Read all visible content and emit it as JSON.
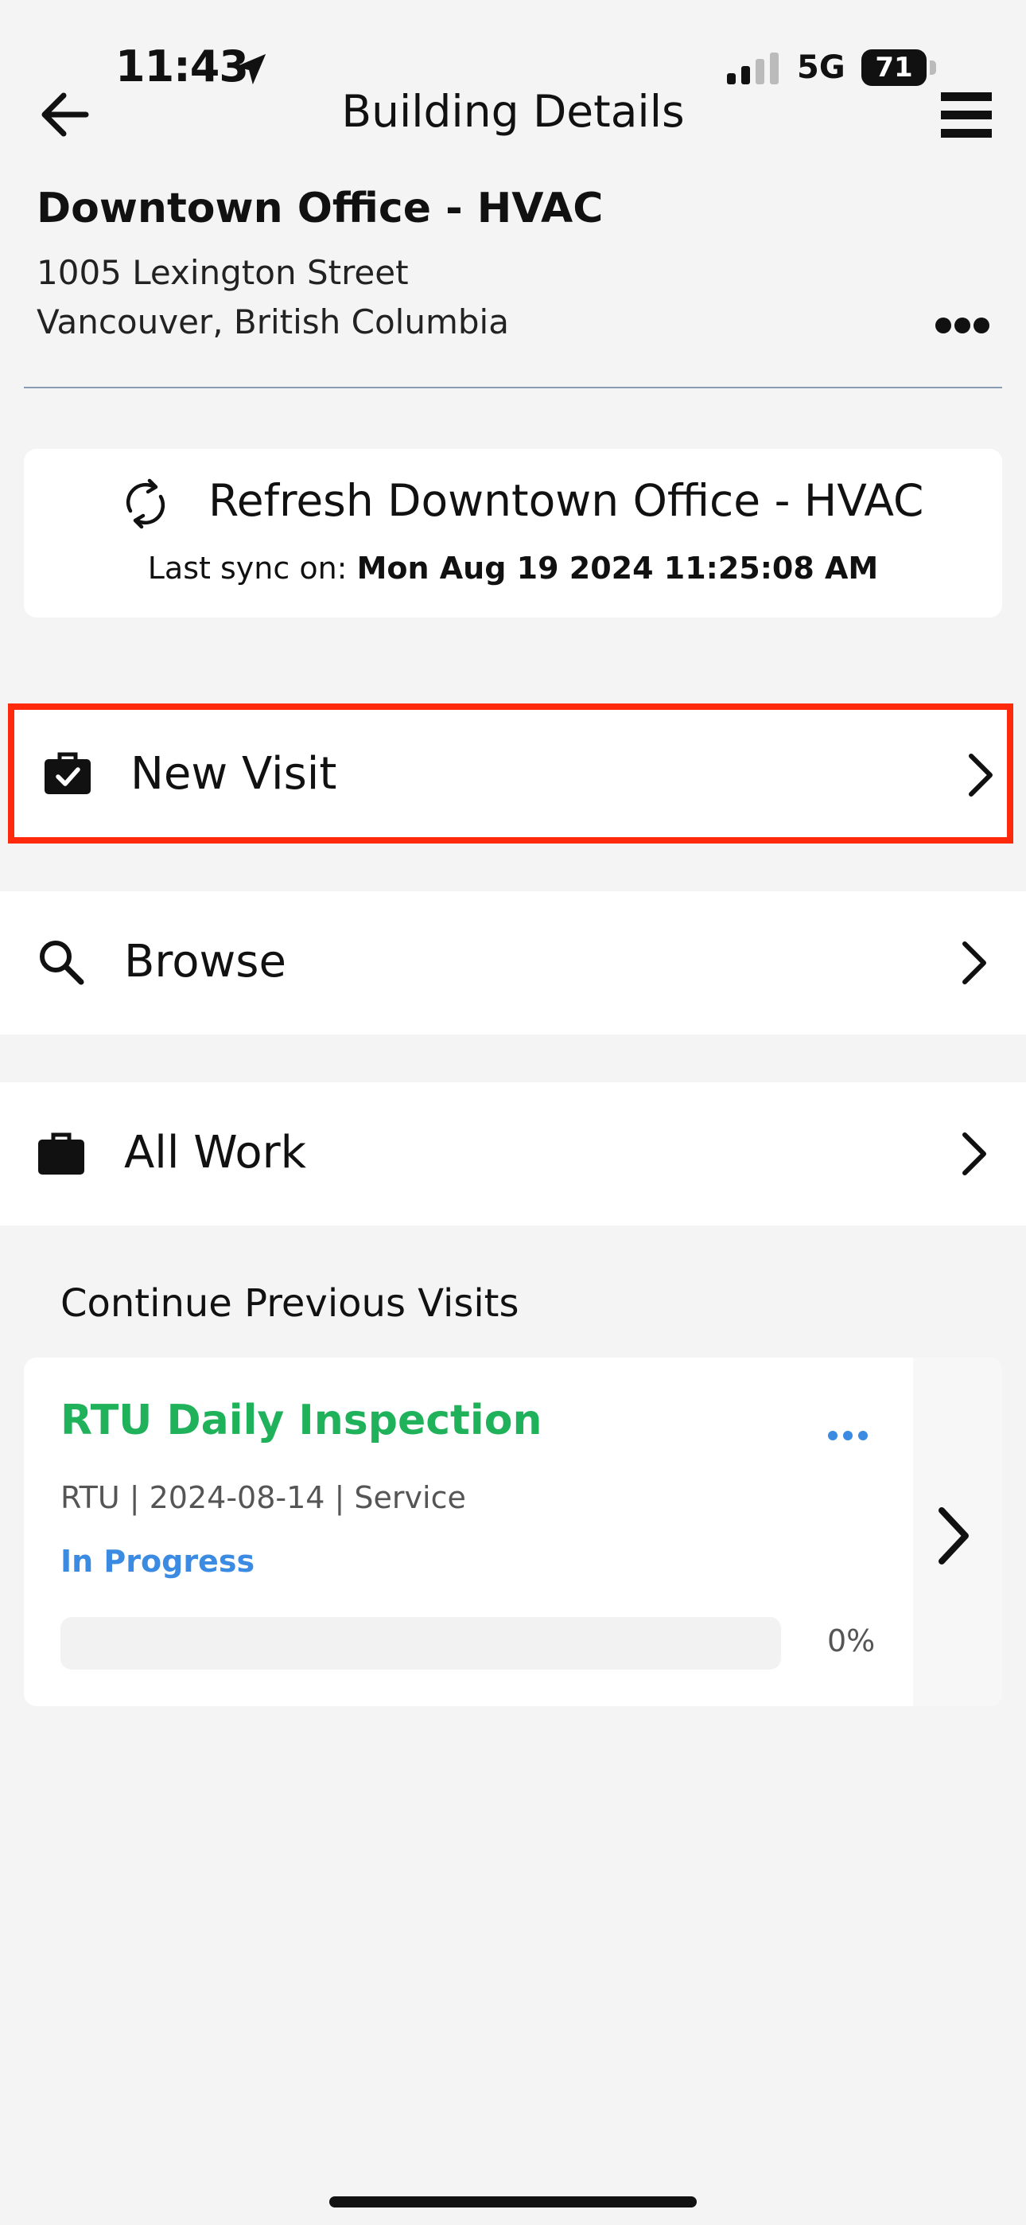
{
  "status_bar": {
    "time": "11:43",
    "network": "5G",
    "battery": "71"
  },
  "header": {
    "title": "Building Details"
  },
  "building": {
    "name": "Downtown Office - HVAC",
    "address_line1": "1005 Lexington Street",
    "address_line2": "Vancouver, British Columbia"
  },
  "refresh": {
    "label": "Refresh Downtown Office - HVAC",
    "last_sync_prefix": "Last sync on:",
    "last_sync_value": "Mon Aug 19 2024 11:25:08 AM"
  },
  "menu": {
    "new_visit": "New Visit",
    "browse": "Browse",
    "all_work": "All Work"
  },
  "previous": {
    "section_title": "Continue Previous Visits",
    "visits": [
      {
        "title": "RTU Daily Inspection",
        "meta": "RTU | 2024-08-14 | Service",
        "status": "In Progress",
        "progress_percent": 0,
        "progress_label": "0%"
      }
    ]
  },
  "colors": {
    "highlight_border": "#ff2a0c",
    "visit_title": "#1fb25a",
    "status_blue": "#3b8be3"
  }
}
